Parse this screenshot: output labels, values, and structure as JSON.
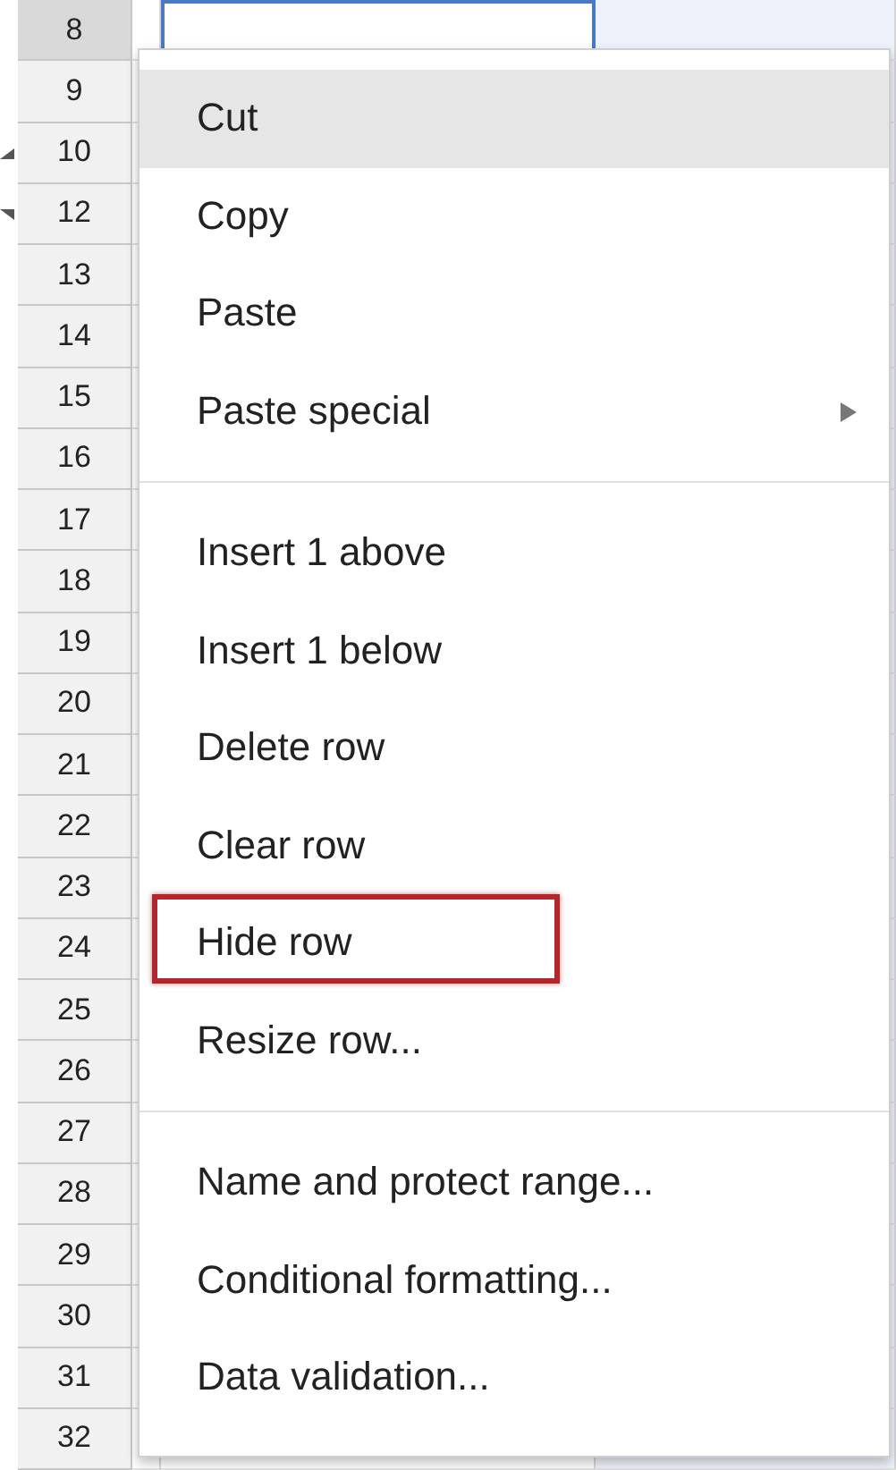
{
  "rows": [
    {
      "label": "8",
      "selected": true,
      "hidden_below": false,
      "hidden_above": false
    },
    {
      "label": "9",
      "selected": false,
      "hidden_below": false,
      "hidden_above": false
    },
    {
      "label": "10",
      "selected": false,
      "hidden_below": true,
      "hidden_above": false
    },
    {
      "label": "12",
      "selected": false,
      "hidden_below": false,
      "hidden_above": true
    },
    {
      "label": "13",
      "selected": false,
      "hidden_below": false,
      "hidden_above": false
    },
    {
      "label": "14",
      "selected": false,
      "hidden_below": false,
      "hidden_above": false
    },
    {
      "label": "15",
      "selected": false,
      "hidden_below": false,
      "hidden_above": false
    },
    {
      "label": "16",
      "selected": false,
      "hidden_below": false,
      "hidden_above": false
    },
    {
      "label": "17",
      "selected": false,
      "hidden_below": false,
      "hidden_above": false
    },
    {
      "label": "18",
      "selected": false,
      "hidden_below": false,
      "hidden_above": false
    },
    {
      "label": "19",
      "selected": false,
      "hidden_below": false,
      "hidden_above": false
    },
    {
      "label": "20",
      "selected": false,
      "hidden_below": false,
      "hidden_above": false
    },
    {
      "label": "21",
      "selected": false,
      "hidden_below": false,
      "hidden_above": false
    },
    {
      "label": "22",
      "selected": false,
      "hidden_below": false,
      "hidden_above": false
    },
    {
      "label": "23",
      "selected": false,
      "hidden_below": false,
      "hidden_above": false
    },
    {
      "label": "24",
      "selected": false,
      "hidden_below": false,
      "hidden_above": false
    },
    {
      "label": "25",
      "selected": false,
      "hidden_below": false,
      "hidden_above": false
    },
    {
      "label": "26",
      "selected": false,
      "hidden_below": false,
      "hidden_above": false
    },
    {
      "label": "27",
      "selected": false,
      "hidden_below": false,
      "hidden_above": false
    },
    {
      "label": "28",
      "selected": false,
      "hidden_below": false,
      "hidden_above": false
    },
    {
      "label": "29",
      "selected": false,
      "hidden_below": false,
      "hidden_above": false
    },
    {
      "label": "30",
      "selected": false,
      "hidden_below": false,
      "hidden_above": false
    },
    {
      "label": "31",
      "selected": false,
      "hidden_below": false,
      "hidden_above": false
    },
    {
      "label": "32",
      "selected": false,
      "hidden_below": false,
      "hidden_above": false
    }
  ],
  "context_menu": {
    "groups": [
      [
        {
          "label": "Cut",
          "hovered": true,
          "submenu": false,
          "highlighted": false
        },
        {
          "label": "Copy",
          "hovered": false,
          "submenu": false,
          "highlighted": false
        },
        {
          "label": "Paste",
          "hovered": false,
          "submenu": false,
          "highlighted": false
        },
        {
          "label": "Paste special",
          "hovered": false,
          "submenu": true,
          "highlighted": false
        }
      ],
      [
        {
          "label": "Insert 1 above",
          "hovered": false,
          "submenu": false,
          "highlighted": false
        },
        {
          "label": "Insert 1 below",
          "hovered": false,
          "submenu": false,
          "highlighted": false
        },
        {
          "label": "Delete row",
          "hovered": false,
          "submenu": false,
          "highlighted": false
        },
        {
          "label": "Clear row",
          "hovered": false,
          "submenu": false,
          "highlighted": false
        },
        {
          "label": "Hide row",
          "hovered": false,
          "submenu": false,
          "highlighted": true
        },
        {
          "label": "Resize row...",
          "hovered": false,
          "submenu": false,
          "highlighted": false
        }
      ],
      [
        {
          "label": "Name and protect range...",
          "hovered": false,
          "submenu": false,
          "highlighted": false
        },
        {
          "label": "Conditional formatting...",
          "hovered": false,
          "submenu": false,
          "highlighted": false
        },
        {
          "label": "Data validation...",
          "hovered": false,
          "submenu": false,
          "highlighted": false
        }
      ]
    ]
  }
}
